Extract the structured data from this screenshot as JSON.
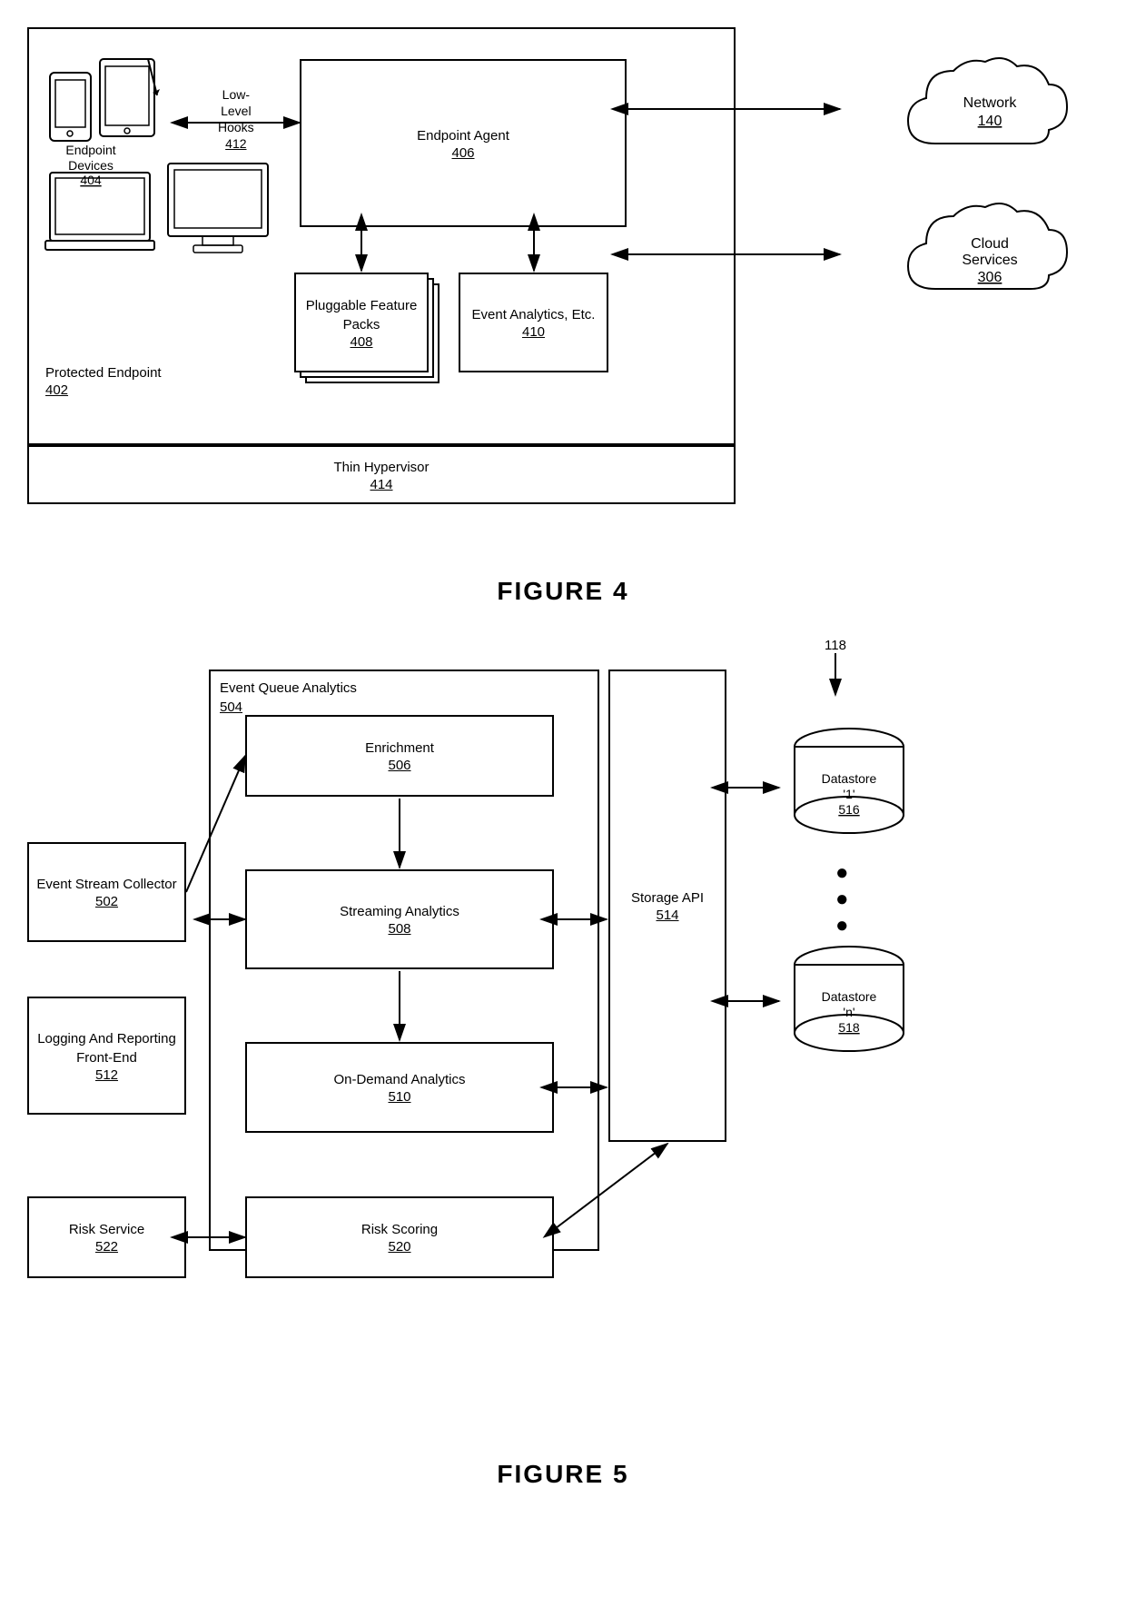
{
  "figure4": {
    "caption": "FIGURE 4",
    "protected_endpoint": {
      "label": "Protected Endpoint",
      "number": "402"
    },
    "endpoint_agent": {
      "label": "Endpoint Agent",
      "number": "406"
    },
    "thin_hypervisor": {
      "label": "Thin Hypervisor",
      "number": "414"
    },
    "low_level_hooks": {
      "label": "Low-\nLevel\nHooks",
      "number": "412"
    },
    "endpoint_devices": {
      "label": "Endpoint\nDevices",
      "number": "404"
    },
    "pluggable_packs": {
      "label": "Pluggable\nFeature\nPacks",
      "number": "408"
    },
    "event_analytics": {
      "label": "Event\nAnalytics,\nEtc.",
      "number": "410"
    },
    "network": {
      "label": "Network",
      "number": "140"
    },
    "cloud_services": {
      "label": "Cloud\nServices",
      "number": "306"
    }
  },
  "figure5": {
    "caption": "FIGURE 5",
    "event_stream_collector": {
      "label": "Event Stream\nCollector",
      "number": "502"
    },
    "event_queue_analytics": {
      "label": "Event Queue Analytics",
      "number": "504"
    },
    "enrichment": {
      "label": "Enrichment",
      "number": "506"
    },
    "streaming_analytics": {
      "label": "Streaming\nAnalytics",
      "number": "508"
    },
    "on_demand_analytics": {
      "label": "On-Demand\nAnalytics",
      "number": "510"
    },
    "logging_reporting": {
      "label": "Logging\nAnd Reporting\nFront-End",
      "number": "512"
    },
    "storage_api": {
      "label": "Storage\nAPI",
      "number": "514"
    },
    "datastore1": {
      "label": "Datastore\n'1'",
      "number": "516"
    },
    "datastoren": {
      "label": "Datastore\n'n'",
      "number": "518"
    },
    "risk_service": {
      "label": "Risk\nService",
      "number": "522"
    },
    "risk_scoring": {
      "label": "Risk\nScoring",
      "number": "520"
    },
    "ref_118": "118"
  }
}
